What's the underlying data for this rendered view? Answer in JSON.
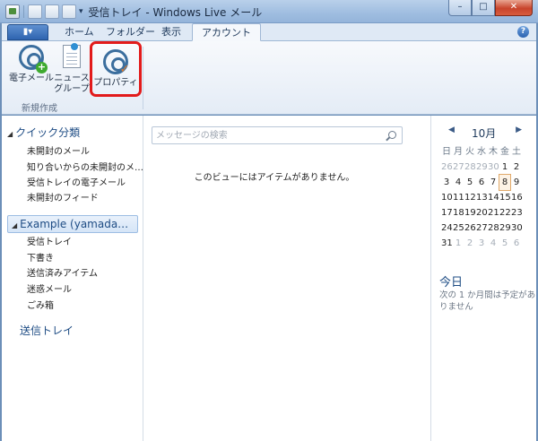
{
  "window": {
    "title": "受信トレイ - Windows Live メール",
    "controls": {
      "minimize": "–",
      "maximize": "□",
      "close": "✕"
    }
  },
  "ribbon": {
    "file_menu_label": "▮▾",
    "tabs": [
      {
        "label": "ホーム",
        "active": false
      },
      {
        "label": "フォルダー",
        "active": false
      },
      {
        "label": "表示",
        "active": false
      },
      {
        "label": "アカウント",
        "active": true
      }
    ],
    "help_label": "?",
    "buttons": [
      {
        "id": "email",
        "label": "電子メール",
        "icon": "email-add-icon"
      },
      {
        "id": "news",
        "label_line1": "ニュース",
        "label_line2": "グループ",
        "icon": "newsgroup-icon"
      },
      {
        "id": "properties",
        "label": "プロパティ",
        "icon": "properties-icon",
        "highlighted": true,
        "highlight_color": "#e21b1b"
      }
    ],
    "group_label": "新規作成"
  },
  "folders": {
    "quick": {
      "header": "クイック分類",
      "items": [
        "未開封のメール",
        "知り合いからの未開封のメ…",
        "受信トレイの電子メール",
        "未開封のフィード"
      ]
    },
    "account": {
      "header": "Example (yamada…",
      "items": [
        "受信トレイ",
        "下書き",
        "送信済みアイテム",
        "迷惑メール",
        "ごみ箱"
      ]
    },
    "outbox": "送信トレイ"
  },
  "messages": {
    "search_placeholder": "メッセージの検索",
    "empty_text": "このビューにはアイテムがありません。"
  },
  "calendar": {
    "month": "10月",
    "weekdays": [
      "日",
      "月",
      "火",
      "水",
      "木",
      "金",
      "土"
    ],
    "weeks": [
      [
        "26",
        "27",
        "28",
        "29",
        "30",
        "1",
        "2"
      ],
      [
        "3",
        "4",
        "5",
        "6",
        "7",
        "8",
        "9"
      ],
      [
        "10",
        "11",
        "12",
        "13",
        "14",
        "15",
        "16"
      ],
      [
        "17",
        "18",
        "19",
        "20",
        "21",
        "22",
        "23"
      ],
      [
        "24",
        "25",
        "26",
        "27",
        "28",
        "29",
        "30"
      ],
      [
        "31",
        "1",
        "2",
        "3",
        "4",
        "5",
        "6"
      ]
    ],
    "today_day": "8",
    "today_title": "今日",
    "today_text": "次の 1 か月間は予定がありません"
  }
}
